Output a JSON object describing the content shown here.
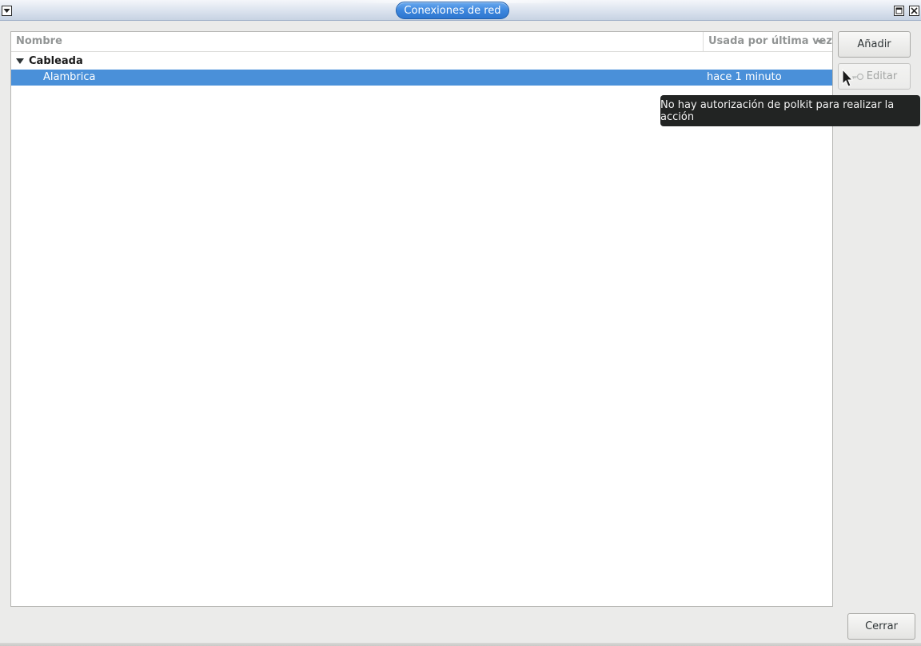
{
  "window": {
    "title": "Conexiones de red"
  },
  "tree": {
    "columns": {
      "name": "Nombre",
      "last_used": "Usada por última vez"
    },
    "group": {
      "label": "Cableada"
    },
    "connection": {
      "name": "Alambrica",
      "last_used": "hace 1 minuto"
    }
  },
  "buttons": {
    "add": "Añadir",
    "edit": "Editar",
    "close": "Cerrar"
  },
  "tooltip": {
    "text": "No hay autorización de polkit para realizar la acción"
  },
  "colors": {
    "selection": "#4a90d9",
    "title_pill": "#3d87de",
    "tooltip_bg": "#222423"
  },
  "icons": {
    "window_menu": "chevron-down-icon",
    "maximize": "maximize-icon",
    "close": "close-icon",
    "edit_lock": "lock-icon",
    "sort": "sort-descending-icon",
    "expander": "expander-open-icon"
  }
}
